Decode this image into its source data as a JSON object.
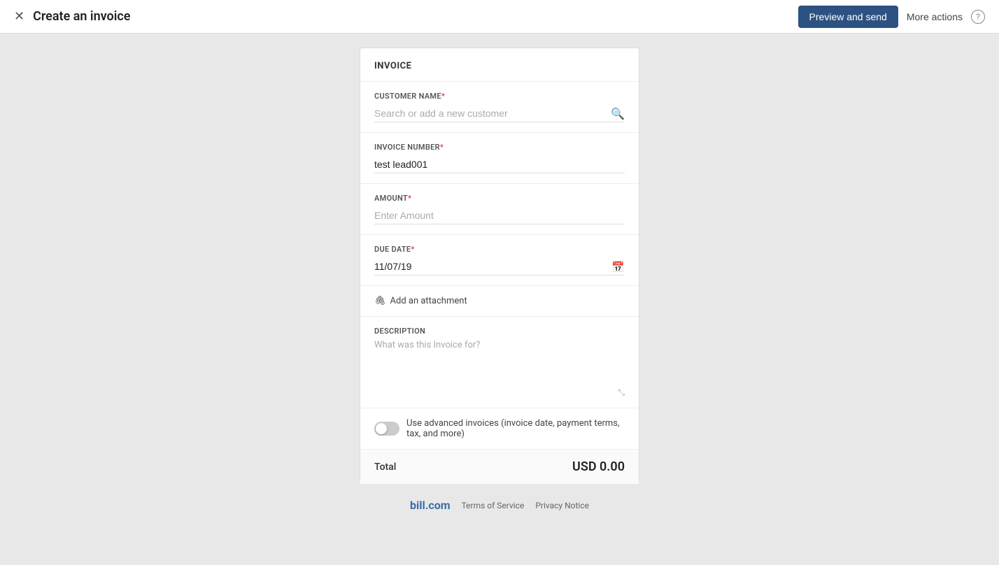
{
  "header": {
    "close_icon": "✕",
    "title": "Create an invoice",
    "preview_button": "Preview and send",
    "more_actions": "More actions",
    "help_icon": "?"
  },
  "invoice": {
    "section_title": "INVOICE",
    "customer_name": {
      "label": "CUSTOMER NAME",
      "required": "*",
      "placeholder": "Search or add a new customer",
      "value": ""
    },
    "invoice_number": {
      "label": "INVOICE NUMBER",
      "required": "*",
      "placeholder": "",
      "value": "test lead001"
    },
    "amount": {
      "label": "AMOUNT",
      "required": "*",
      "placeholder": "Enter Amount",
      "value": ""
    },
    "due_date": {
      "label": "DUE DATE",
      "required": "*",
      "placeholder": "",
      "value": "11/07/19"
    },
    "attachment": {
      "icon": "📎",
      "label": "Add an attachment"
    },
    "description": {
      "label": "DESCRIPTION",
      "placeholder": "What was this Invoice for?",
      "value": ""
    },
    "advanced_toggle": {
      "label": "Use advanced invoices (invoice date, payment terms, tax, and more)"
    },
    "total": {
      "label": "Total",
      "value": "USD 0.00"
    }
  },
  "footer": {
    "brand_text": "bill",
    "brand_suffix": ".com",
    "terms_link": "Terms of Service",
    "privacy_link": "Privacy Notice"
  }
}
